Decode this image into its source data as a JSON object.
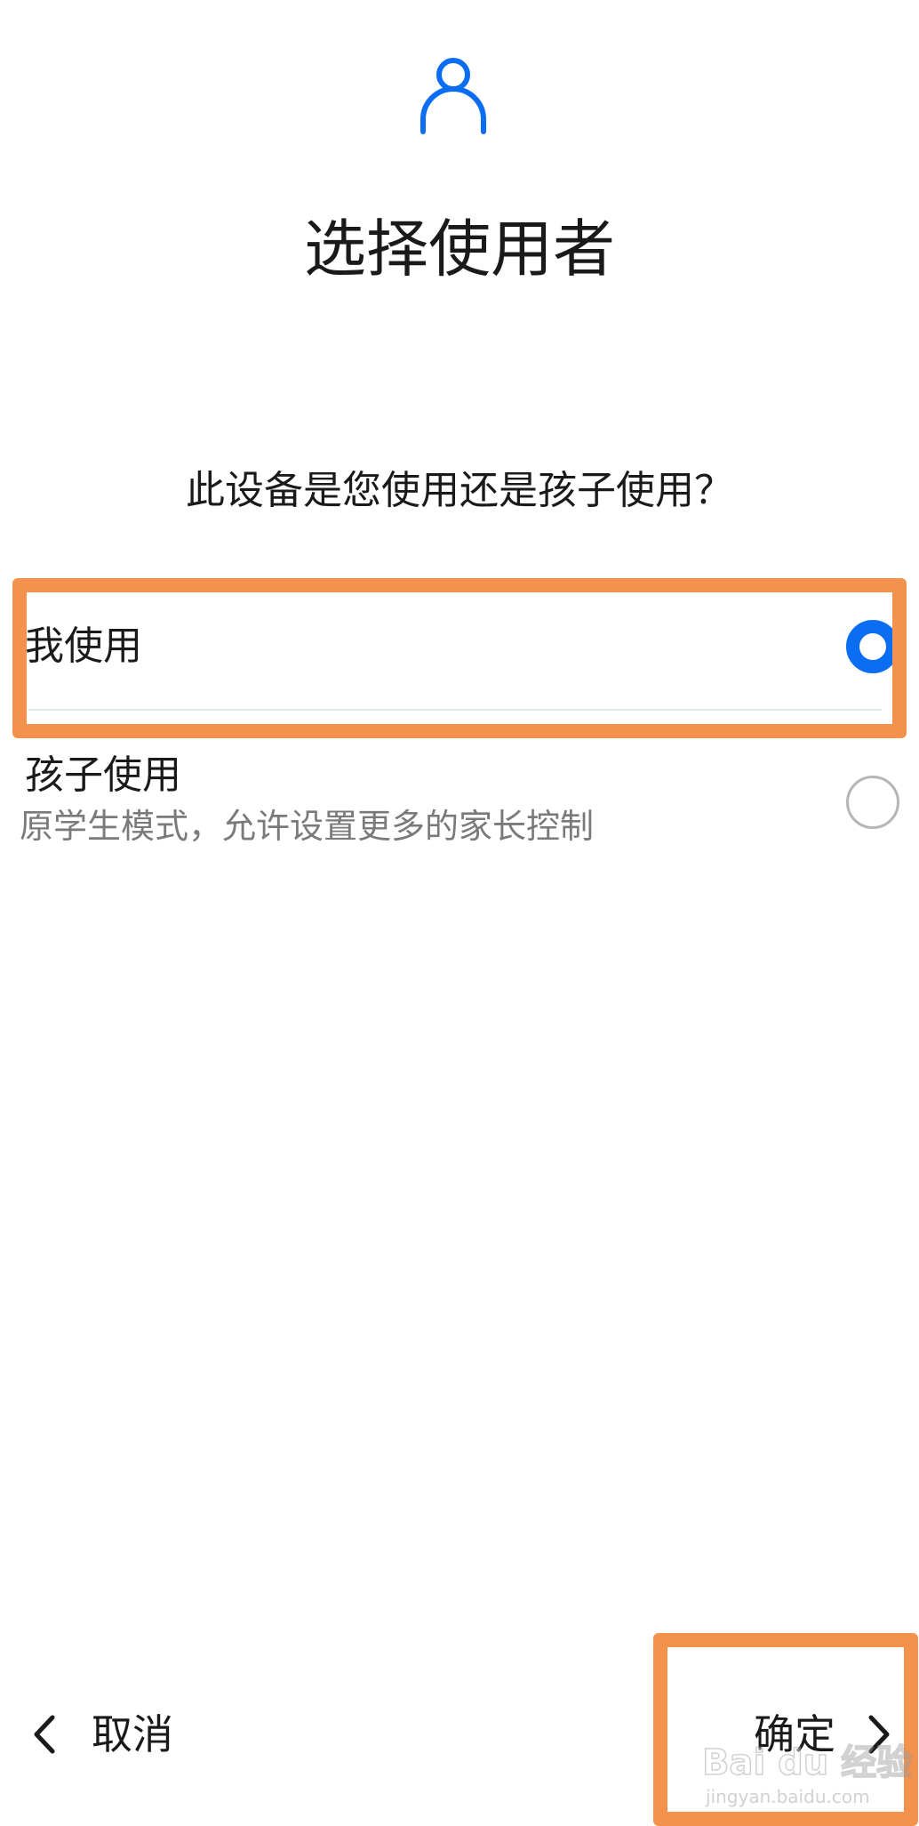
{
  "header": {
    "icon": "user-icon",
    "title": "选择使用者"
  },
  "question": "此设备是您使用还是孩子使用？",
  "options": [
    {
      "label": "我使用",
      "description": "",
      "selected": true
    },
    {
      "label": "孩子使用",
      "description": "原学生模式，允许设置更多的家长控制",
      "selected": false
    }
  ],
  "footer": {
    "cancel_label": "取消",
    "cancel_icon": "chevron-left-icon",
    "confirm_label": "确定",
    "confirm_icon": "chevron-right-icon"
  },
  "watermark": {
    "text": "Bai du 经验",
    "url_text": "jingyan.baidu.com"
  },
  "colors": {
    "accent": "#0a6df2",
    "highlight": "#f2924d",
    "text_primary": "#1a1a1a",
    "text_secondary": "#7a7a7a",
    "radio_off": "#b5b5b5"
  }
}
